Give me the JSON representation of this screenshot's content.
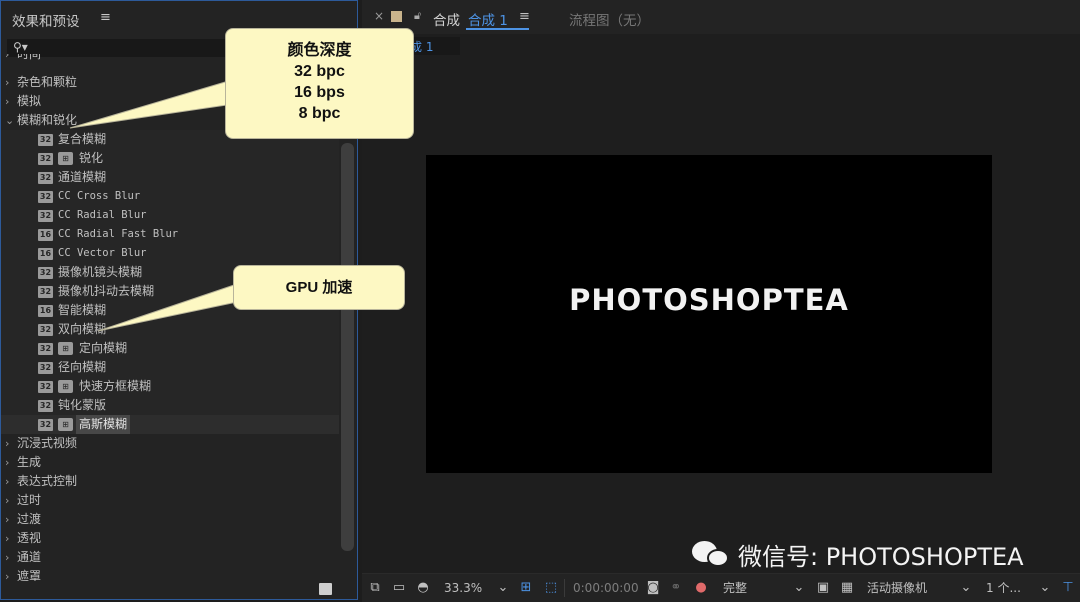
{
  "effects_panel": {
    "title": "效果和预设",
    "menu_icon": "≡",
    "search_placeholder": "",
    "categories_top": [
      "时间",
      "杂色和颗粒",
      "模拟"
    ],
    "open_category": "模糊和锐化",
    "effects": [
      {
        "bpc": "32",
        "gpu": false,
        "label": "复合模糊",
        "mono": false
      },
      {
        "bpc": "32",
        "gpu": true,
        "label": "锐化",
        "mono": false
      },
      {
        "bpc": "32",
        "gpu": false,
        "label": "通道模糊",
        "mono": false
      },
      {
        "bpc": "32",
        "gpu": false,
        "label": "CC Cross Blur",
        "mono": true
      },
      {
        "bpc": "32",
        "gpu": false,
        "label": "CC Radial Blur",
        "mono": true
      },
      {
        "bpc": "16",
        "gpu": false,
        "label": "CC Radial Fast Blur",
        "mono": true
      },
      {
        "bpc": "16",
        "gpu": false,
        "label": "CC Vector Blur",
        "mono": true
      },
      {
        "bpc": "32",
        "gpu": false,
        "label": "摄像机镜头模糊",
        "mono": false
      },
      {
        "bpc": "32",
        "gpu": false,
        "label": "摄像机抖动去模糊",
        "mono": false
      },
      {
        "bpc": "16",
        "gpu": false,
        "label": "智能模糊",
        "mono": false
      },
      {
        "bpc": "32",
        "gpu": false,
        "label": "双向模糊",
        "mono": false
      },
      {
        "bpc": "32",
        "gpu": true,
        "label": "定向模糊",
        "mono": false
      },
      {
        "bpc": "32",
        "gpu": false,
        "label": "径向模糊",
        "mono": false
      },
      {
        "bpc": "32",
        "gpu": true,
        "label": "快速方框模糊",
        "mono": false
      },
      {
        "bpc": "32",
        "gpu": false,
        "label": "钝化蒙版",
        "mono": false
      },
      {
        "bpc": "32",
        "gpu": true,
        "label": "高斯模糊",
        "mono": false,
        "selected": true
      }
    ],
    "categories_bottom": [
      "沉浸式视频",
      "生成",
      "表达式控制",
      "过时",
      "过渡",
      "透视",
      "通道",
      "遮罩"
    ]
  },
  "composition": {
    "close": "×",
    "tab_prefix": "合成",
    "comp_name": "合成 1",
    "menu_icon": "≡",
    "flowchart_tab": "流程图（无）",
    "sub_tab": "成 1",
    "canvas_text": "PHOTOSHOPTEA"
  },
  "toolbar": {
    "zoom": "33.3%",
    "timecode": "0:00:00:00",
    "resolution": "完整",
    "camera": "活动摄像机",
    "views": "1 个..."
  },
  "callouts": {
    "bpc": [
      "颜色深度",
      "32 bpc",
      "16 bps",
      "8 bpc"
    ],
    "gpu": "GPU 加速"
  },
  "watermark": "微信号: PHOTOSHOPTEA",
  "colors": {
    "accent_blue": "#4d93e4",
    "callout_bg": "#fdf8c3",
    "panel_bg": "#232323",
    "canvas_bg": "#000000"
  }
}
